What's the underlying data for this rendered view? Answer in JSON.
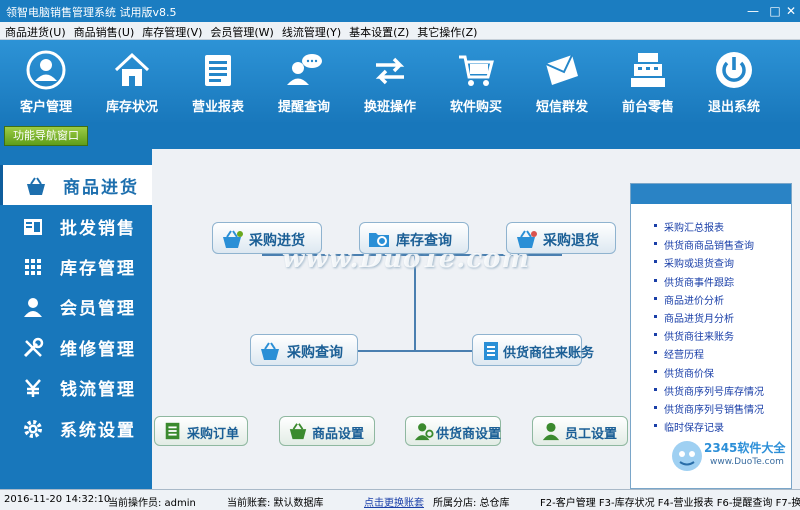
{
  "window": {
    "title": "领智电脑销售管理系统 试用版v8.5"
  },
  "menu": [
    "商品进货(U)",
    "商品销售(U)",
    "库存管理(V)",
    "会员管理(W)",
    "线流管理(Y)",
    "基本设置(Z)",
    "其它操作(Z)"
  ],
  "toolbar": [
    {
      "label": "客户管理",
      "icon": "user-circle-icon"
    },
    {
      "label": "库存状况",
      "icon": "house-icon"
    },
    {
      "label": "营业报表",
      "icon": "report-icon"
    },
    {
      "label": "提醒查询",
      "icon": "chat-user-icon"
    },
    {
      "label": "换班操作",
      "icon": "swap-arrows-icon"
    },
    {
      "label": "软件购买",
      "icon": "cart-icon"
    },
    {
      "label": "短信群发",
      "icon": "envelope-icon"
    },
    {
      "label": "前台零售",
      "icon": "cash-register-icon"
    },
    {
      "label": "退出系统",
      "icon": "power-icon"
    }
  ],
  "nav_button": "功能导航窗口",
  "sidebar": [
    {
      "label": "商品进货",
      "icon": "basket-icon",
      "active": true
    },
    {
      "label": "批发销售",
      "icon": "sheet-icon",
      "active": false
    },
    {
      "label": "库存管理",
      "icon": "grid-icon",
      "active": false
    },
    {
      "label": "会员管理",
      "icon": "person-icon",
      "active": false
    },
    {
      "label": "维修管理",
      "icon": "tools-icon",
      "active": false
    },
    {
      "label": "钱流管理",
      "icon": "yen-icon",
      "active": false
    },
    {
      "label": "系统设置",
      "icon": "gear-icon",
      "active": false
    }
  ],
  "flow": {
    "purchase_in": "采购进货",
    "stock_query": "库存查询",
    "purchase_return": "采购退货",
    "purchase_query": "采购查询",
    "supplier_account": "供货商往来账务",
    "purchase_order": "采购订单",
    "goods_setting": "商品设置",
    "supplier_setting": "供货商设置",
    "staff_setting": "员工设置"
  },
  "watermark": "www.DuoTe.com",
  "right_links": [
    "采购汇总报表",
    "供货商商品销售查询",
    "采购或退货查询",
    "供货商事件跟踪",
    "商品进价分析",
    "商品进货月分析",
    "供货商往来账务",
    "经营历程",
    "供货商价保",
    "供货商序列号库存情况",
    "供货商序列号销售情况",
    "临时保存记录"
  ],
  "logo": {
    "brand": "2345软件大全",
    "url": "www.DuoTe.com"
  },
  "status": {
    "datetime": "2016-11-20 14:32:10",
    "operator": "当前操作员: admin",
    "account": "当前账套: 默认数据库",
    "switch_link": "点击更换账套",
    "branch": "所属分店: 总仓库",
    "shortcuts": "F2-客户管理 F3-库存状况 F4-营业报表 F6-提醒查询 F7-换"
  }
}
